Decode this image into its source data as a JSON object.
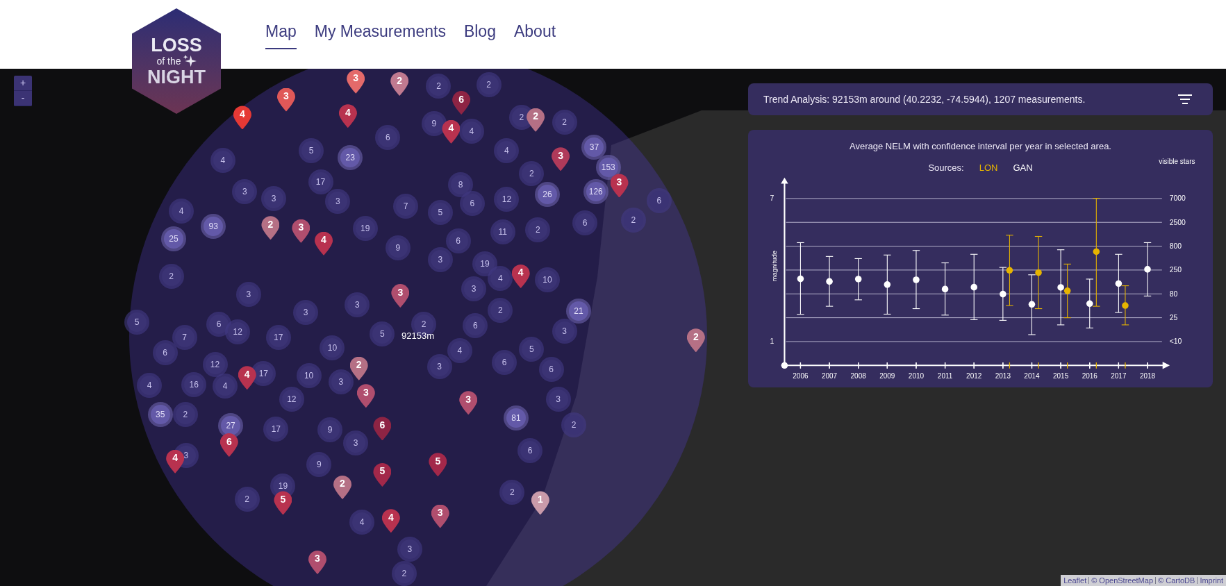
{
  "logo": {
    "lines": [
      "LOSS",
      "of the",
      "NIGHT"
    ]
  },
  "nav": [
    {
      "label": "Map",
      "selected": true
    },
    {
      "label": "My Measurements",
      "selected": false
    },
    {
      "label": "Blog",
      "selected": false
    },
    {
      "label": "About",
      "selected": false
    }
  ],
  "zoom_controls": [
    "+",
    "-"
  ],
  "map": {
    "radius_label": "92153m",
    "clusters": [
      {
        "count": "2"
      },
      {
        "count": "2"
      },
      {
        "count": "6"
      },
      {
        "count": "9"
      },
      {
        "count": "4"
      },
      {
        "count": "2"
      },
      {
        "count": "2"
      },
      {
        "count": "4"
      },
      {
        "count": "5"
      },
      {
        "count": "23"
      },
      {
        "count": "4"
      },
      {
        "count": "37"
      },
      {
        "count": "17"
      },
      {
        "count": "8"
      },
      {
        "count": "2"
      },
      {
        "count": "153"
      },
      {
        "count": "3"
      },
      {
        "count": "3"
      },
      {
        "count": "3"
      },
      {
        "count": "7"
      },
      {
        "count": "6"
      },
      {
        "count": "12"
      },
      {
        "count": "26"
      },
      {
        "count": "126"
      },
      {
        "count": "6"
      },
      {
        "count": "4"
      },
      {
        "count": "93"
      },
      {
        "count": "19"
      },
      {
        "count": "5"
      },
      {
        "count": "11"
      },
      {
        "count": "2"
      },
      {
        "count": "6"
      },
      {
        "count": "2"
      },
      {
        "count": "25"
      },
      {
        "count": "9"
      },
      {
        "count": "6"
      },
      {
        "count": "2"
      },
      {
        "count": "3"
      },
      {
        "count": "19"
      },
      {
        "count": "4"
      },
      {
        "count": "10"
      },
      {
        "count": "3"
      },
      {
        "count": "3"
      },
      {
        "count": "5"
      },
      {
        "count": "6"
      },
      {
        "count": "3"
      },
      {
        "count": "3"
      },
      {
        "count": "2"
      },
      {
        "count": "6"
      },
      {
        "count": "2"
      },
      {
        "count": "21"
      },
      {
        "count": "7"
      },
      {
        "count": "12"
      },
      {
        "count": "17"
      },
      {
        "count": "10"
      },
      {
        "count": "5"
      },
      {
        "count": "4"
      },
      {
        "count": "5"
      },
      {
        "count": "3"
      },
      {
        "count": "6"
      },
      {
        "count": "12"
      },
      {
        "count": "17"
      },
      {
        "count": "3"
      },
      {
        "count": "6"
      },
      {
        "count": "6"
      },
      {
        "count": "4"
      },
      {
        "count": "16"
      },
      {
        "count": "4"
      },
      {
        "count": "10"
      },
      {
        "count": "3"
      },
      {
        "count": "35"
      },
      {
        "count": "2"
      },
      {
        "count": "12"
      },
      {
        "count": "81"
      },
      {
        "count": "3"
      },
      {
        "count": "27"
      },
      {
        "count": "17"
      },
      {
        "count": "9"
      },
      {
        "count": "3"
      },
      {
        "count": "2"
      },
      {
        "count": "3"
      },
      {
        "count": "9"
      },
      {
        "count": "6"
      },
      {
        "count": "19"
      },
      {
        "count": "2"
      },
      {
        "count": "2"
      },
      {
        "count": "4"
      },
      {
        "count": "3"
      },
      {
        "count": "2"
      }
    ],
    "pins": [
      {
        "count": "3",
        "color": "#e46a6a"
      },
      {
        "count": "2",
        "color": "#c07a90"
      },
      {
        "count": "4",
        "color": "#e53935"
      },
      {
        "count": "3",
        "color": "#e05858"
      },
      {
        "count": "4",
        "color": "#b8324f"
      },
      {
        "count": "6",
        "color": "#8e2444"
      },
      {
        "count": "4",
        "color": "#b8324f"
      },
      {
        "count": "2",
        "color": "#b57085"
      },
      {
        "count": "3",
        "color": "#b03a5a"
      },
      {
        "count": "3",
        "color": "#b8324f"
      },
      {
        "count": "2",
        "color": "#b57085"
      },
      {
        "count": "3",
        "color": "#b04e6e"
      },
      {
        "count": "4",
        "color": "#b8324f"
      },
      {
        "count": "4",
        "color": "#b8324f"
      },
      {
        "count": "3",
        "color": "#b04e6e"
      },
      {
        "count": "2",
        "color": "#b57085"
      },
      {
        "count": "2",
        "color": "#b57085"
      },
      {
        "count": "4",
        "color": "#b8324f"
      },
      {
        "count": "3",
        "color": "#b04e6e"
      },
      {
        "count": "3",
        "color": "#b04e6e"
      },
      {
        "count": "6",
        "color": "#b8324f"
      },
      {
        "count": "6",
        "color": "#8e2444"
      },
      {
        "count": "4",
        "color": "#b8324f"
      },
      {
        "count": "5",
        "color": "#a3284a"
      },
      {
        "count": "2",
        "color": "#b57085"
      },
      {
        "count": "5",
        "color": "#a3284a"
      },
      {
        "count": "5",
        "color": "#b8324f"
      },
      {
        "count": "3",
        "color": "#b04e6e"
      },
      {
        "count": "1",
        "color": "#c99aaa"
      },
      {
        "count": "4",
        "color": "#b8324f"
      },
      {
        "count": "3",
        "color": "#b04e6e"
      }
    ]
  },
  "trend_bar": {
    "text": "Trend Analysis: 92153m around (40.2232, -74.5944), 1207 measurements."
  },
  "chart_panel": {
    "chart_data": {
      "type": "scatter",
      "title": "Average NELM with confidence interval per year in selected area.",
      "legend_title": "Sources:",
      "ylabel": "magnitude",
      "y2label": "visible stars",
      "categories": [
        "2006",
        "2007",
        "2008",
        "2009",
        "2010",
        "2011",
        "2012",
        "2013",
        "2014",
        "2015",
        "2016",
        "2017",
        "2018"
      ],
      "ylim": [
        0,
        7.65
      ],
      "yticks": [
        1,
        7
      ],
      "y2ticks": [
        "7000",
        "2500",
        "800",
        "250",
        "80",
        "25",
        "<10"
      ],
      "series": [
        {
          "name": "LON",
          "color": "#e6b400",
          "values": [
            null,
            null,
            null,
            null,
            null,
            null,
            null,
            3.99,
            3.89,
            3.13,
            4.77,
            2.51,
            null
          ],
          "errors": [
            null,
            null,
            null,
            null,
            null,
            null,
            null,
            [
              2.51,
              5.46
            ],
            [
              2.38,
              5.41
            ],
            [
              2.0,
              4.25
            ],
            [
              2.48,
              7.01
            ],
            [
              1.7,
              3.34
            ],
            null
          ]
        },
        {
          "name": "GAN",
          "color": "#ffffff",
          "values": [
            3.63,
            3.52,
            3.62,
            3.39,
            3.59,
            3.2,
            3.28,
            2.99,
            2.56,
            3.27,
            2.59,
            3.43,
            4.03
          ],
          "errors": [
            [
              2.14,
              5.15
            ],
            [
              2.48,
              4.57
            ],
            [
              2.75,
              4.48
            ],
            [
              2.15,
              4.63
            ],
            [
              2.38,
              4.82
            ],
            [
              2.11,
              4.3
            ],
            [
              1.92,
              4.66
            ],
            [
              1.89,
              4.11
            ],
            [
              1.29,
              3.8
            ],
            [
              1.7,
              4.85
            ],
            [
              1.57,
              3.62
            ],
            [
              2.22,
              4.66
            ],
            [
              2.91,
              5.15
            ]
          ]
        }
      ]
    }
  },
  "attribution": [
    "Leaflet",
    "© OpenStreetMap",
    "© CartoDB",
    "Imprint"
  ]
}
